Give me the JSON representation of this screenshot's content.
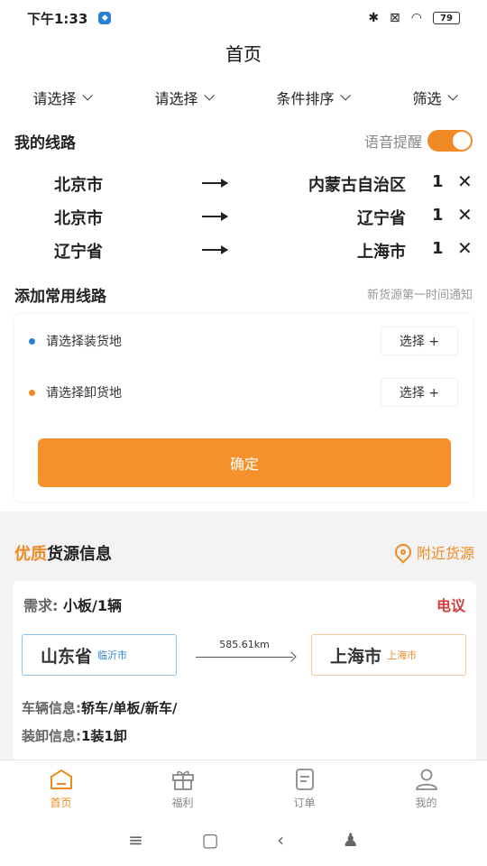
{
  "status": {
    "time": "下午1:33",
    "battery": "79"
  },
  "header": {
    "title": "首页"
  },
  "filters": [
    "请选择",
    "请选择",
    "条件排序",
    "筛选"
  ],
  "my_routes": {
    "title": "我的线路",
    "voice_label": "语音提醒",
    "routes": [
      {
        "from": "北京市",
        "to": "内蒙古自治区",
        "count": "1"
      },
      {
        "from": "北京市",
        "to": "辽宁省",
        "count": "1"
      },
      {
        "from": "辽宁省",
        "to": "上海市",
        "count": "1"
      }
    ]
  },
  "add_route": {
    "title": "添加常用线路",
    "hint": "新货源第一时间通知",
    "load_placeholder": "请选择装货地",
    "unload_placeholder": "请选择卸货地",
    "choose_label": "选择 +",
    "confirm_label": "确定"
  },
  "quality": {
    "title_highlight": "优质",
    "title_rest": "货源信息",
    "nearby_label": "附近货源"
  },
  "cargo": {
    "need_label": "需求:",
    "need_value": "小板/1辆",
    "price": "电议",
    "from_province": "山东省",
    "from_city": "临沂市",
    "distance": "585.61km",
    "to_province": "上海市",
    "to_city": "上海市",
    "vehicle_label": "车辆信息:",
    "vehicle_value": "轿车/单板/新车/",
    "load_label": "装卸信息:",
    "load_value": "1装1卸"
  },
  "tabbar": [
    {
      "label": "首页",
      "icon": "home-icon"
    },
    {
      "label": "福利",
      "icon": "gift-icon"
    },
    {
      "label": "订单",
      "icon": "order-icon"
    },
    {
      "label": "我的",
      "icon": "user-icon"
    }
  ],
  "colors": {
    "accent": "#f08a24",
    "price": "#d23b3b",
    "from_blue": "#2a80d0"
  }
}
